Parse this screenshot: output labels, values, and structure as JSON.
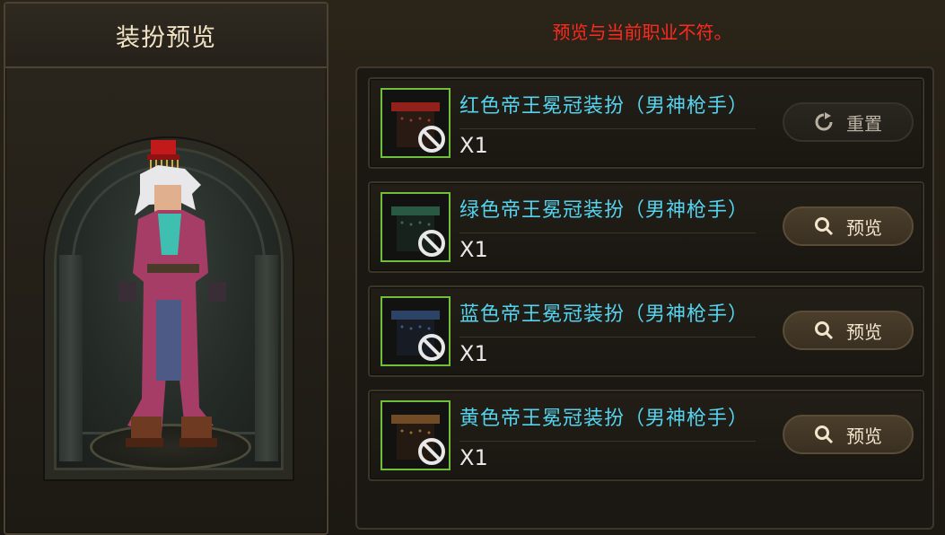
{
  "left_panel": {
    "title": "装扮预览"
  },
  "right_panel": {
    "warning": "预览与当前职业不符。",
    "items": [
      {
        "name": "红色帝王冕冠装扮（男神枪手）",
        "qty": "X1",
        "button_label": "重置",
        "button_type": "reset",
        "hat_color": "#b3261e"
      },
      {
        "name": "绿色帝王冕冠装扮（男神枪手）",
        "qty": "X1",
        "button_label": "预览",
        "button_type": "preview",
        "hat_color": "#2f6b4f"
      },
      {
        "name": "蓝色帝王冕冠装扮（男神枪手）",
        "qty": "X1",
        "button_label": "预览",
        "button_type": "preview",
        "hat_color": "#34507a"
      },
      {
        "name": "黄色帝王冕冠装扮（男神枪手）",
        "qty": "X1",
        "button_label": "预览",
        "button_type": "preview",
        "hat_color": "#8a5a2a"
      }
    ]
  },
  "colors": {
    "warning": "#ff2a1f",
    "item_name": "#55d3ee",
    "icon_border": "#6fbf3c",
    "title": "#f1e3c4"
  }
}
